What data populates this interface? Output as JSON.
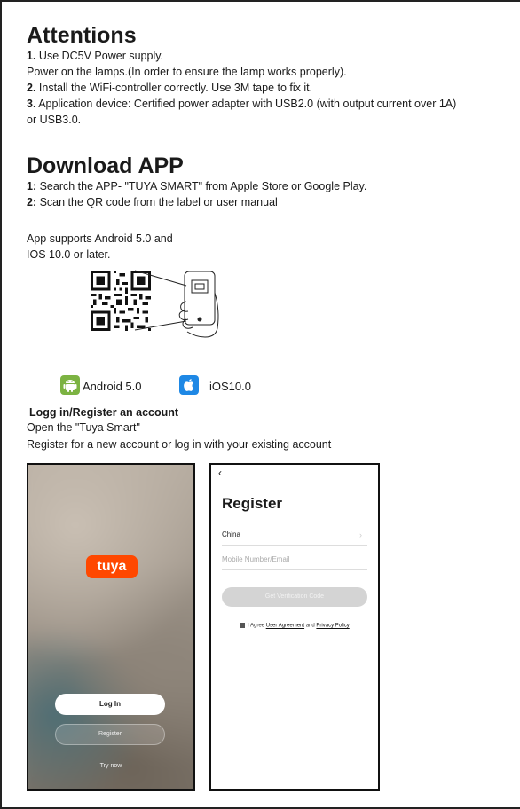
{
  "attentions": {
    "title": "Attentions",
    "item1_num": "1.",
    "item1_text": " Use DC5V Power supply.",
    "item1_line2": "Power on the lamps.(In order to ensure the lamp works properly).",
    "item2_num": "2.",
    "item2_text": " Install the WiFi-controller correctly. Use 3M tape to fix it.",
    "item3_num": "3.",
    "item3_text": " Application device: Certified power adapter with USB2.0 (with output current over 1A)",
    "item3_line2": "or USB3.0."
  },
  "download": {
    "title": "Download APP",
    "step1_num": "1:",
    "step1_text": " Search the APP- \"TUYA SMART\" from Apple Store or Google Play.",
    "step2_num": "2:",
    "step2_text": " Scan the QR code from the label or user manual",
    "support_line1": "App supports Android 5.0 and",
    "support_line2": "IOS 10.0 or later."
  },
  "os": {
    "android_label": "Android 5.0",
    "ios_label": "iOS10.0",
    "android_color": "#7cb342",
    "ios_color": "#1e88e5",
    "android_icon": "android-icon",
    "ios_icon": "apple-icon"
  },
  "account": {
    "title": "Logg in/Register an account",
    "line1": "Open the \"Tuya Smart\"",
    "line2": "Register for a new account or log in with your existing account"
  },
  "login_screen": {
    "logo": "tuya",
    "login_label": "Log In",
    "register_label": "Register",
    "try_now_label": "Try now",
    "brand_color": "#ff4800"
  },
  "register_screen": {
    "back_icon": "‹",
    "title": "Register",
    "country_value": "China",
    "mobile_placeholder": "Mobile Number/Email",
    "verify_label": "Get Verification Code",
    "agree_prefix": "I Agree ",
    "user_agreement": "User Agreement",
    "agree_and": " and ",
    "privacy_policy": "Privacy Policy"
  }
}
